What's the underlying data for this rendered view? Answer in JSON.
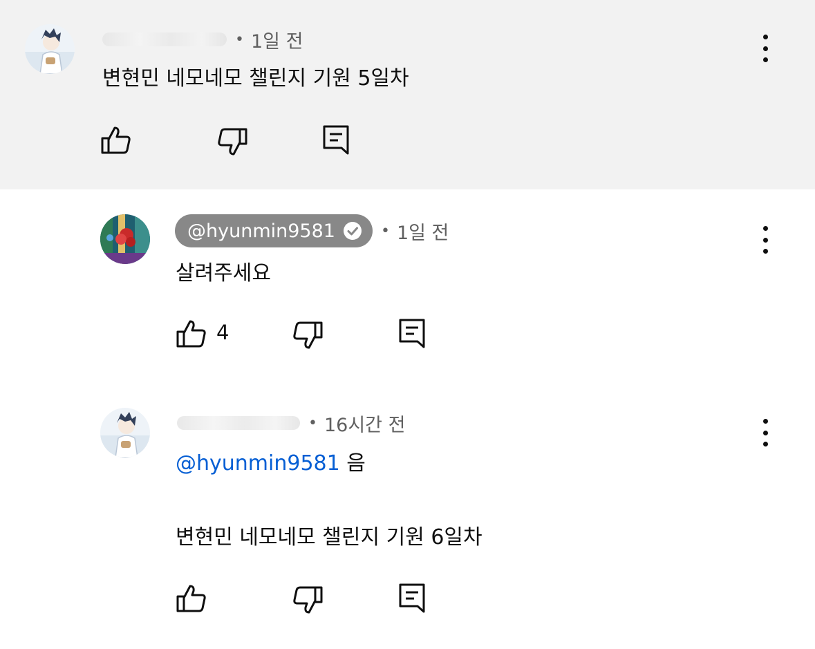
{
  "comments": [
    {
      "author": "",
      "time": "1일 전",
      "text": "변현민 네모네모 챌린지 기원 5일차",
      "likes": ""
    },
    {
      "author": "@hyunmin9581",
      "time": "1일 전",
      "text": "살려주세요",
      "likes": "4"
    },
    {
      "author": "",
      "time": "16시간 전",
      "mention": "@hyunmin9581",
      "text_after_mention": " 음",
      "text": "변현민 네모네모 챌린지 기원 6일차",
      "likes": ""
    }
  ],
  "separator": "•",
  "icons": {
    "like": "thumbs-up-icon",
    "dislike": "thumbs-down-icon",
    "reply": "comment-reply-icon",
    "more": "more-vertical-icon",
    "verified": "verified-check-icon"
  },
  "colors": {
    "highlight_bg": "#f2f2f2",
    "mention": "#065fd4",
    "chip_bg": "#888888"
  }
}
